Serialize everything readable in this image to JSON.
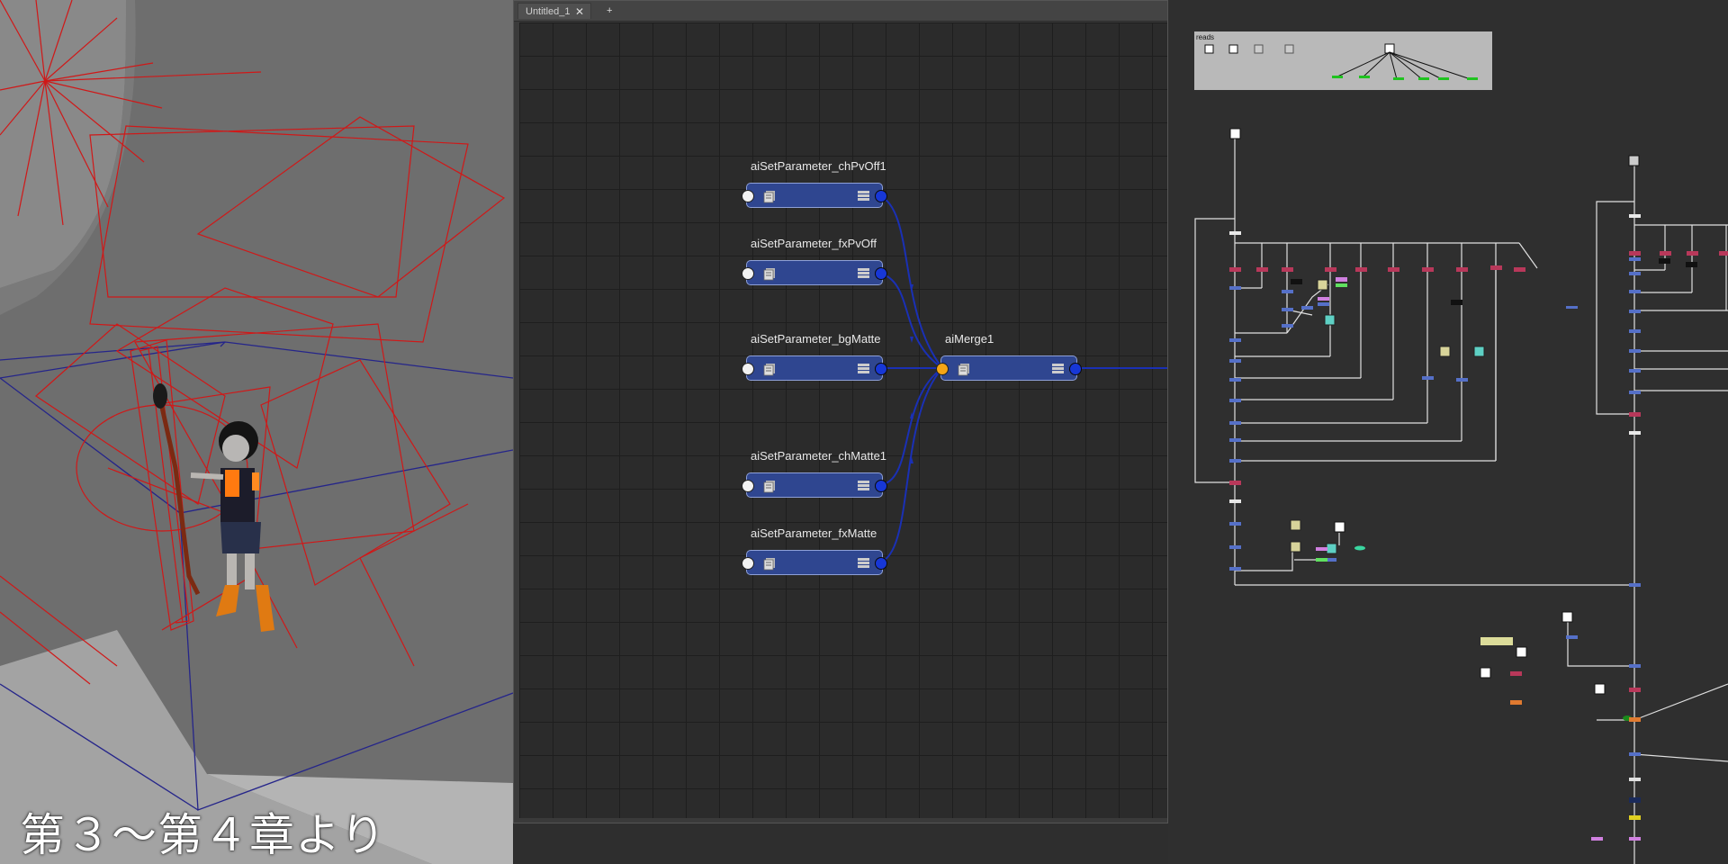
{
  "viewport": {
    "caption": "第３～第４章より",
    "wire_colors": {
      "light": "#d01818",
      "camera": "#25258a",
      "floor": "#a9a9a9",
      "wall": "#585858"
    }
  },
  "node_editor": {
    "tabs": [
      {
        "label": "Untitled_1",
        "close": "✕"
      },
      {
        "label": "+"
      }
    ],
    "nodes": [
      {
        "label": "aiSetParameter_chPvOff1"
      },
      {
        "label": "aiSetParameter_fxPvOff"
      },
      {
        "label": "aiSetParameter_bgMatte"
      },
      {
        "label": "aiSetParameter_chMatte1"
      },
      {
        "label": "aiSetParameter_fxMatte"
      },
      {
        "label": "aiMerge1"
      }
    ],
    "colors": {
      "node": "#2f4690",
      "wire": "#1a30b5",
      "out_port": "#1737d6",
      "merge_in_port": "#f6a515"
    }
  },
  "node_graph": {
    "backdrop_label": "reads",
    "colors": {
      "read": "#d8d8d8",
      "merge": "#b8385a",
      "grade": "#5570c8",
      "backdrop": "#b9b9b9"
    }
  }
}
